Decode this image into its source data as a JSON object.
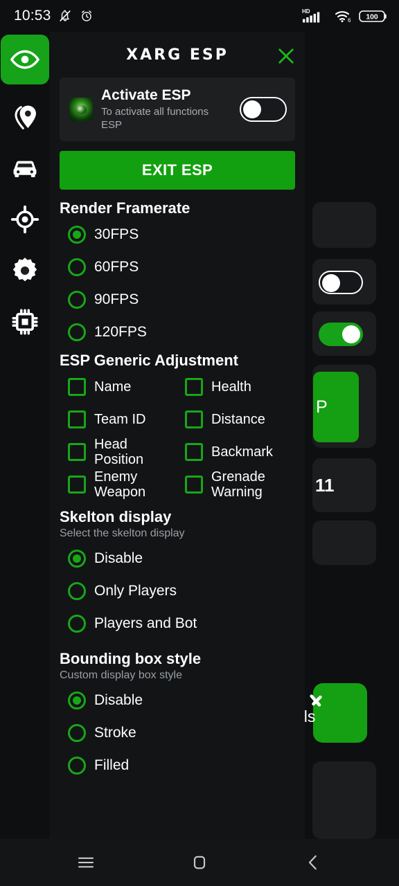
{
  "status_bar": {
    "time": "10:53",
    "icons_left": [
      "bell-muted-icon",
      "alarm-clock-icon"
    ],
    "network_label": "HD",
    "wifi_label": "6",
    "battery_level": "100"
  },
  "sidebar": {
    "items": [
      {
        "icon": "eye-icon",
        "name": "esp",
        "active": true
      },
      {
        "icon": "location-pin-icon",
        "name": "location",
        "active": false
      },
      {
        "icon": "car-icon",
        "name": "vehicle",
        "active": false
      },
      {
        "icon": "crosshair-icon",
        "name": "aim",
        "active": false
      },
      {
        "icon": "gear-icon",
        "name": "settings",
        "active": false
      },
      {
        "icon": "cpu-chip-icon",
        "name": "memory",
        "active": false
      }
    ]
  },
  "panel": {
    "title": "XARG ESP",
    "close_icon": "close-icon",
    "activate_card": {
      "logo_icon": "app-logo-icon",
      "title": "Activate ESP",
      "subtitle": "To activate all functions ESP",
      "toggle_name": "activate-esp-toggle",
      "toggle_on": false
    },
    "exit_button": "EXIT ESP",
    "sections": [
      {
        "key": "framerate",
        "title": "Render Framerate",
        "subtitle": "",
        "type": "radio",
        "options": [
          {
            "label": "30FPS",
            "selected": true
          },
          {
            "label": "60FPS",
            "selected": false
          },
          {
            "label": "90FPS",
            "selected": false
          },
          {
            "label": "120FPS",
            "selected": false
          }
        ]
      },
      {
        "key": "generic",
        "title": "ESP Generic Adjustment",
        "subtitle": "",
        "type": "checkbox-grid",
        "options": [
          {
            "label": "Name",
            "checked": false
          },
          {
            "label": "Health",
            "checked": false
          },
          {
            "label": "Team ID",
            "checked": false
          },
          {
            "label": "Distance",
            "checked": false
          },
          {
            "label": "Head Position",
            "checked": false
          },
          {
            "label": "Backmark",
            "checked": false
          },
          {
            "label": "Enemy Weapon",
            "checked": false
          },
          {
            "label": "Grenade Warning",
            "checked": false
          }
        ]
      },
      {
        "key": "skelton",
        "title": "Skelton display",
        "subtitle": "Select the skelton display",
        "type": "radio",
        "options": [
          {
            "label": "Disable",
            "selected": true
          },
          {
            "label": "Only Players",
            "selected": false
          },
          {
            "label": "Players and Bot",
            "selected": false
          }
        ]
      },
      {
        "key": "bounding",
        "title": "Bounding box style",
        "subtitle": "Custom display box style",
        "type": "radio",
        "options": [
          {
            "label": "Disable",
            "selected": true
          },
          {
            "label": "Stroke",
            "selected": false
          },
          {
            "label": "Filled",
            "selected": false
          }
        ]
      }
    ]
  },
  "background": {
    "partial_text_number": "11",
    "partial_green_button_text": "P",
    "partial_green_card_text": "ols"
  },
  "navbar": {
    "recents_icon": "recents-icon",
    "home_icon": "home-icon",
    "back_icon": "back-icon"
  },
  "colors": {
    "accent_green": "#17a717",
    "button_green": "#13a010",
    "panel_bg": "#121416",
    "page_bg": "#0e0f10",
    "card_bg": "#1d1f21",
    "text_primary": "#ffffff",
    "text_secondary": "#9b9fa3"
  }
}
